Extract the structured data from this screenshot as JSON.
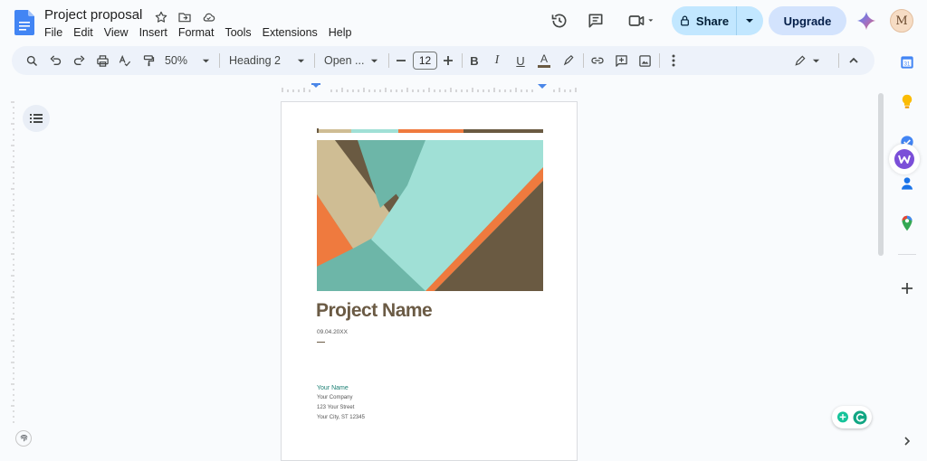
{
  "doc": {
    "title": "Project proposal"
  },
  "menu": [
    "File",
    "Edit",
    "View",
    "Insert",
    "Format",
    "Tools",
    "Extensions",
    "Help"
  ],
  "actions": {
    "share_label": "Share",
    "upgrade_label": "Upgrade",
    "avatar_letter": "M"
  },
  "toolbar": {
    "zoom": "50%",
    "style": "Heading 2",
    "font": "Open ...",
    "font_size": "12"
  },
  "page": {
    "project_name": "Project Name",
    "date": "09.04.20XX",
    "author_name": "Your Name",
    "company": "Your Company",
    "street": "123 Your Street",
    "city": "Your City, ST 12345"
  },
  "side_panel": {
    "calendar_day": "31"
  },
  "colors": {
    "teal_light": "#a0e0d6",
    "teal": "#6db6a8",
    "tan": "#cfbd94",
    "orange": "#ef7a3e",
    "brown": "#6a5a42",
    "accent_text": "#1a7f73"
  }
}
